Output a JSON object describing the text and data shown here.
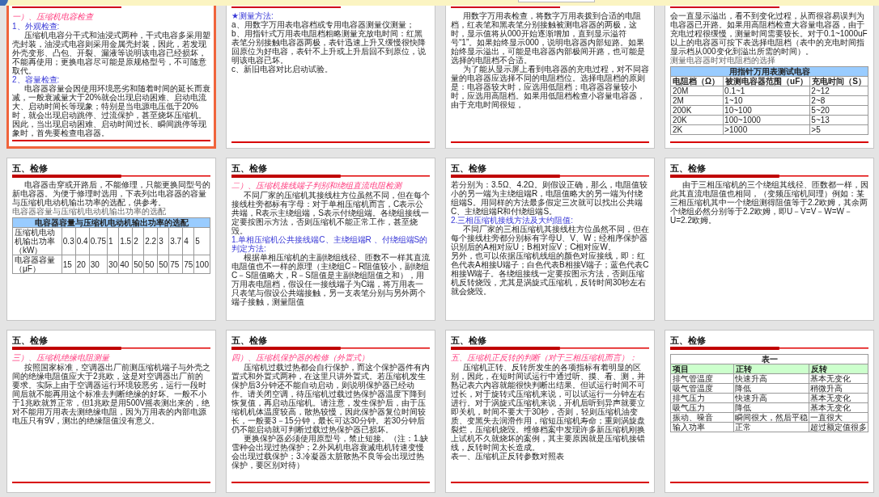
{
  "slides": [
    {
      "selected": true,
      "blocks": [
        {
          "kind": "title_rule"
        },
        {
          "kind": "section",
          "text": "一）、压缩机电容检查"
        },
        {
          "kind": "subhead",
          "text": "1、外观检查:"
        },
        {
          "kind": "para",
          "text": "压缩机电容分干式和油浸式两种，干式电容多采用塑壳封装，油浸式电容则采用金属壳封装，因此，若发现外壳变形、凸包、开裂、漏液等说明该电容已经损坏，不能再使用；更换电容尽可能是原规格型号，不可随意取代。"
        },
        {
          "kind": "subhead",
          "text": "2、容量检查:"
        },
        {
          "kind": "para",
          "text": "电容器容量会因使用环境恶劣和随着时间的延长而衰减，一般衰减量大于20%就会出现启动困难、启动电流大、启动时间长等现象；特别是当电源电压低于20%时，就会出现启动跳停、过流保护，甚至烧坏压缩机。因此，当出现启动困难、启动时间过长、瞬间跳停等现象时，首先要检查电容器。"
        },
        {
          "kind": "footer_rule"
        }
      ]
    },
    {
      "selected": false,
      "blocks": [
        {
          "kind": "title_rule"
        },
        {
          "kind": "subhead",
          "text": "★测量方法:"
        },
        {
          "kind": "line",
          "text": "a、用数字万用表电容档或专用电容器测量仪测量；"
        },
        {
          "kind": "line",
          "text": "b、用指针式万用表电阻档粗略测量充放电时间：红黑表笔分别接触电容器两极，表针迅速上升又缓慢很快降回原位为好电容，表针不上升或上升后回不到原位，说明该电容已坏。"
        },
        {
          "kind": "line",
          "text": "c、新旧电容对比启动试验。"
        },
        {
          "kind": "footer_rule"
        }
      ]
    },
    {
      "selected": false,
      "blocks": [
        {
          "kind": "title_rule"
        },
        {
          "kind": "para",
          "text": "用数字万用表检查，将数字万用表拨到合适的电阻档，红表笔和黑表笔分别接触被测电容器的两极，这时，显示值将从000开始逐渐增加，直到显示溢符号“1”。如果始终显示000，说明电容器内部短路。如果始终显示溢出，可能是电容器内部极间开路，也可能是选择的电阻档不合适。"
        },
        {
          "kind": "para",
          "text": "为了能从显示屏上看到电容器的充电过程，对不同容量的电容器应选择不同的电阻档位。选择电阻档的原则是：电容器较大时，应选用低阻档；电容器容量较小时，应选用高阻档。如果用低阻档检查小容量电容器，由于充电时间很短，"
        },
        {
          "kind": "footer_rule"
        }
      ]
    },
    {
      "selected": false,
      "blocks": [
        {
          "kind": "title_rule"
        },
        {
          "kind": "line",
          "text": "会一直显示溢出，看不到变化过程，从而很容易误判为电容器已开路。如果用高阻档检查大容量电容器，由于充电过程很缓慢，测量时间需要较长。对于0.1~1000uF以上的电容器可按下表选择电阻档（表中的充电时间指显示档从000变化到溢出所需的时间）。"
        },
        {
          "kind": "caption",
          "text": "测量电容器时对电阻档的选择"
        },
        {
          "kind": "table",
          "title_shaded": true,
          "header_shaded": false,
          "title": "用指针万用表测试电容",
          "header": [
            "电阻档（Ω）",
            "被测电容器范围（uF）",
            "充电时间（S）"
          ],
          "rows": [
            [
              "20M",
              "0.1~1",
              "2~12"
            ],
            [
              "2M",
              "1~10",
              "2~8"
            ],
            [
              "200K",
              "10~100",
              "5~20"
            ],
            [
              "20K",
              "100~1000",
              "5~13"
            ],
            [
              "2K",
              ">1000",
              ">5"
            ]
          ]
        },
        {
          "kind": "footer_rule"
        }
      ]
    },
    {
      "selected": false,
      "blocks": [
        {
          "kind": "title",
          "text": "五、检修"
        },
        {
          "kind": "para",
          "text": "电容器击穿或开路后，不能修理，只能更换同型号的新电容器。为便于修理时选用，下表列出电容器的容量与压缩机电动机输出功率的选配，供参考。"
        },
        {
          "kind": "caption",
          "text": "电容器容量与压缩机电动机输出功率的选配"
        },
        {
          "kind": "table",
          "title_shaded": true,
          "title": "电容器容量与压缩机电动机输出功率的选配",
          "rows": [
            [
              "压缩机电动机输出功率（kW）",
              "0.3",
              "0.4",
              "0.75",
              "1",
              "1.5",
              "2",
              "2.2",
              "3",
              "3.7",
              "4",
              "5"
            ],
            [
              "电容器容量（μF）",
              "15",
              "20",
              "30",
              "30",
              "40",
              "50",
              "50",
              "50",
              "75",
              "75",
              "100"
            ]
          ]
        }
      ]
    },
    {
      "selected": false,
      "blocks": [
        {
          "kind": "title",
          "text": "五、检修"
        },
        {
          "kind": "section",
          "text": "二）、压缩机接线端子判别和绕组直流电阻检测"
        },
        {
          "kind": "para",
          "text": "不同厂家的压缩机其接线柱方位虽然不同，但在每个接线柱旁都标有字母：对于单相压缩机而言，C表示公共端，R表示主绕组端，S表示付绕组端。各绕组接线一定要按图示方法，否则压缩机不能正常工作，甚至烧毁。"
        },
        {
          "kind": "subhead",
          "text": "1.单相压缩机公共接线端C、主绕组端R 、付绕组端S的判定方法:"
        },
        {
          "kind": "para",
          "text": "根据单相压缩机的主副绕组线径、匝数不一样其直流电阻值也不一样的原理（主绕组C－R阻值较小，副绕组C－S阻值略大，R－S阻值是主副绕组阻值之和），用万用表电阻档，假设任一接线端子为C端，将万用表一只表笔与假设公共端接触，另一支表笔分别与另外两个端子接触，测量阻值"
        }
      ]
    },
    {
      "selected": false,
      "blocks": [
        {
          "kind": "title",
          "text": "五、检修"
        },
        {
          "kind": "line",
          "text": "若分别为：3.5Ω、4.2Ω。则假设正确，那么，电阻值较小的另一端为主绕组端R，电阻值略大的另一端为付绕组端S。用同样的方法最多假定三次就可以找出公共端C、主绕组端R和付绕组端S。"
        },
        {
          "kind": "subhead",
          "text": "2.三相压缩机接线方法及大约阻值:"
        },
        {
          "kind": "para",
          "text": "不同厂家的三相压缩机其接线柱方位虽然不同，但在每个接线柱旁都分别标有字母U、V、W；经相序保护器识别后的A相对应U；B相对应V；C相对应W。"
        },
        {
          "kind": "line",
          "text": "另外，也可以依据压缩机线组的颜色对应接线，即：红色代表A相接U端子；白色代表B相接V端子；蓝色代表C相接W端子。各绕组接线一定要按图示方法，否则压缩机反转烧毁，尤其是涡旋式压缩机，反转时间30秒左右就会烧毁。"
        }
      ]
    },
    {
      "selected": false,
      "blocks": [
        {
          "kind": "title",
          "text": "五、检修"
        },
        {
          "kind": "para",
          "text": "由于三相压缩机的三个绕组其线径、匝数都一样，因此其直流电阻值也相同，（变频压缩机同理）例如：某三相压缩机其中一个绕组测得阻值等于2.2欧姆，其余两个绕组必然分别等于2.2欧姆，即U－V=V－W=W－U=2.2欧姆。"
        }
      ]
    },
    {
      "selected": false,
      "blocks": [
        {
          "kind": "title",
          "text": "五、检修"
        },
        {
          "kind": "section",
          "text": "三）、压缩机绝缘电阻测量"
        },
        {
          "kind": "para",
          "text": "按照国家标准，空调器出厂前测压缩机端子与外壳之间的绝缘电阻值应大于2兆欧，这是对空调器出厂前的要求。实际上由于空调器运行环境较恶劣，运行一段时间后就不能再用这个标准去判断绝缘的好坏。一般不小于1兆欧就算正常，但1兆欧是用500V摇表测出来的，绝对不能用万用表去测绝缘电阻，因为万用表的内部电源电压只有9V，测出的绝缘阻值没有意义。"
        },
        {
          "kind": "footer_rule"
        }
      ]
    },
    {
      "selected": false,
      "blocks": [
        {
          "kind": "title",
          "text": "五、检修"
        },
        {
          "kind": "section",
          "text": "四）、压缩机保护器的检修（外置式）"
        },
        {
          "kind": "para",
          "text": "压缩机过载过热都会自行保护，而这个保护器件有内置式和外置式两种，在这里只讲外置式。若压缩机发生保护后3分钟还不能自动启动，则说明保护器已经动作。请关闭空调，待压缩机过载过热保护器温度下降到恢复值，再启动压缩机。请注意，发生保护后，由于压缩机机体温度较高，散热较慢，因此保护器复位时间较长，一般要3－15分钟，最长可达30分钟。若30分钟后仍不能启动就可判断过载过热保护器已损坏。"
        },
        {
          "kind": "para",
          "text": "更换保护器必须使用原型号，禁止短接。（注：1.缺雪种会出现过热保护；2.外风机电容衰减电机转速变慢会出现过载保护；3.冷凝器太脏散热不良等会出现过热保护，要区别对待）"
        },
        {
          "kind": "footer_rule"
        }
      ]
    },
    {
      "selected": false,
      "blocks": [
        {
          "kind": "title",
          "text": "五、检修"
        },
        {
          "kind": "section",
          "text": "五、压缩机正反转的判断（对于三相压缩机而言）："
        },
        {
          "kind": "para",
          "text": "压缩机正转、反转所发生的各项指标有着明显的区别，因此，在短时间试运行中通过听、摸、看、测，并熟记表六内容就能很快判断出结果。但试运行时间不可过长，对于旋转式压缩机来说，可以试运行一分钟左右进行。对于涡旋式压缩机来说，开机后听到异声就要立即关机，时间不要大于30秒，否则，轻则压缩机油变质、变黑失去润滑作用，缩短压缩机寿命；重则涡旋盘裂烂，压缩机烧毁。维修档案中发现许多新压缩机刚换上试机不久就烧坏的案例，其主要原因就是压缩机接错线，反转时间太长造成。"
        },
        {
          "kind": "line",
          "text": "表一、压缩机正反转参数对照表"
        },
        {
          "kind": "footer_rule"
        }
      ]
    },
    {
      "selected": false,
      "blocks": [
        {
          "kind": "title",
          "text": "五、检修"
        },
        {
          "kind": "table",
          "title_shaded": false,
          "header_shaded": true,
          "title": "表一",
          "header": [
            "项目",
            "正转",
            "反转"
          ],
          "rows": [
            [
              "排气管温度",
              "快速升高",
              "基本无变化"
            ],
            [
              "吸气管温度",
              "降低",
              "稍微升高"
            ],
            [
              "排气压力",
              "快速升高",
              "基本无变化"
            ],
            [
              "吸气压力",
              "降低",
              "基本无变化"
            ],
            [
              "振动、噪音",
              "瞬间很大，然后平稳",
              "一直很大"
            ],
            [
              "输入功率",
              "正常",
              "超过额定值很多"
            ]
          ]
        },
        {
          "kind": "footer_rule"
        }
      ]
    }
  ]
}
